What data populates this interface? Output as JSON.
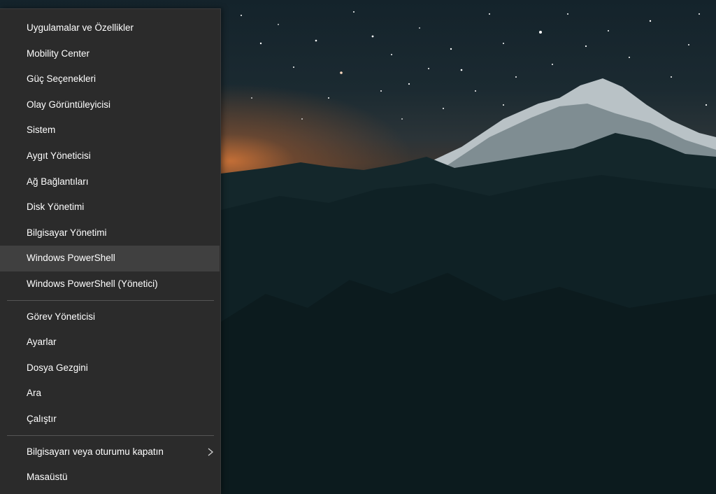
{
  "menu": {
    "group1": [
      {
        "id": "apps-features",
        "label": "Uygulamalar ve Özellikler"
      },
      {
        "id": "mobility-center",
        "label": "Mobility Center"
      },
      {
        "id": "power-options",
        "label": "Güç Seçenekleri"
      },
      {
        "id": "event-viewer",
        "label": "Olay Görüntüleyicisi"
      },
      {
        "id": "system",
        "label": "Sistem"
      },
      {
        "id": "device-manager",
        "label": "Aygıt Yöneticisi"
      },
      {
        "id": "network-connections",
        "label": "Ağ Bağlantıları"
      },
      {
        "id": "disk-management",
        "label": "Disk Yönetimi"
      },
      {
        "id": "computer-management",
        "label": "Bilgisayar Yönetimi"
      },
      {
        "id": "powershell",
        "label": "Windows PowerShell",
        "hover": true
      },
      {
        "id": "powershell-admin",
        "label": "Windows PowerShell (Yönetici)"
      }
    ],
    "group2": [
      {
        "id": "task-manager",
        "label": "Görev Yöneticisi"
      },
      {
        "id": "settings",
        "label": "Ayarlar"
      },
      {
        "id": "file-explorer",
        "label": "Dosya Gezgini"
      },
      {
        "id": "search",
        "label": "Ara"
      },
      {
        "id": "run",
        "label": "Çalıştır"
      }
    ],
    "group3": [
      {
        "id": "shutdown-signout",
        "label": "Bilgisayarı veya oturumu kapatın",
        "submenu": true,
        "icon": "chevron-right-icon"
      },
      {
        "id": "desktop",
        "label": "Masaüstü"
      }
    ]
  },
  "colors": {
    "menu_background": "#2b2b2b",
    "hover_background": "#404040",
    "text": "#ffffff",
    "separator": "#555555"
  }
}
